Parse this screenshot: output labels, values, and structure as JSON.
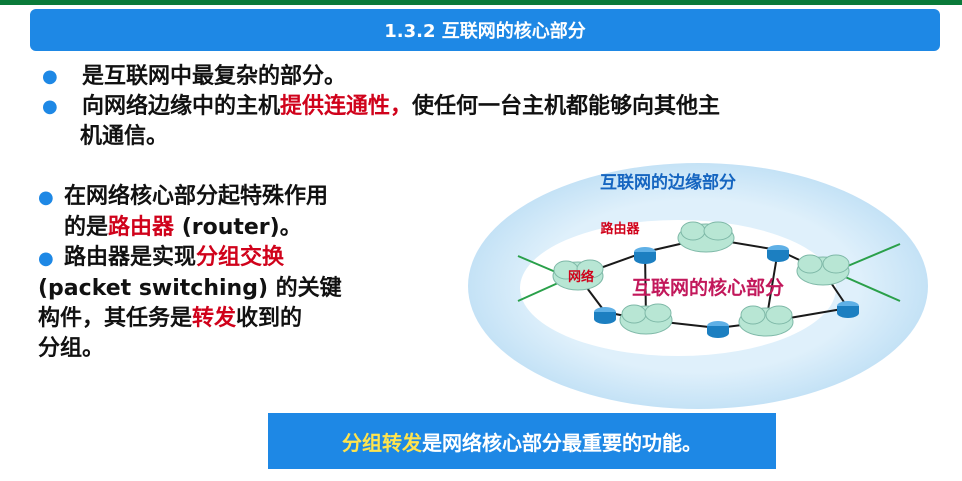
{
  "header": {
    "title": "1.3.2  互联网的核心部分"
  },
  "top_bullets": [
    {
      "text": "是互联网中最复杂的部分。"
    },
    {
      "pre": "向网络边缘中的主机",
      "highlight": "提供连通性，",
      "post": "使任何一台主机都能够向其他主",
      "cont": "机通信。"
    }
  ],
  "left_bullets": {
    "b1_line1": "在网络核心部分起特殊作用",
    "b1_pre": "的是",
    "b1_highlight": "路由器",
    "b1_post": " (router)。",
    "b2_pre": "路由器是实现",
    "b2_highlight": "分组交换",
    "b2_line2": "(packet switching) 的关键",
    "b2_line3_pre": "构件，其任务是",
    "b2_line3_highlight": "转发",
    "b2_line3_post": "收到的",
    "b2_line4": "分组。"
  },
  "diagram": {
    "edge_label": "互联网的边缘部分",
    "router_label": "路由器",
    "network_label": "网络",
    "core_label": "互联网的核心部分",
    "colors": {
      "outer": "#cfe6f7",
      "inner": "#ffffff",
      "cloud": "#b8e6d4",
      "router": "#1c7fc1",
      "link": "#2aa04a"
    }
  },
  "footer": {
    "highlight": "分组转发",
    "rest": "是网络核心部分最重要的功能。"
  }
}
